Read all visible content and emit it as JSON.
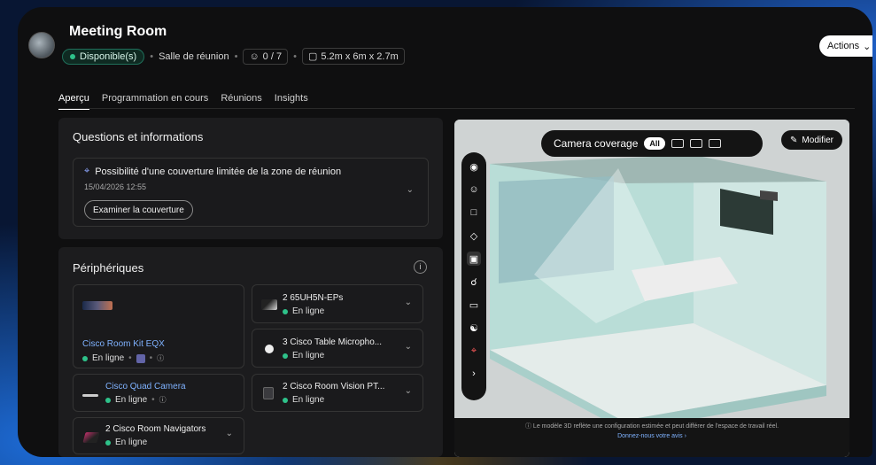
{
  "header": {
    "title": "Meeting Room",
    "status": "Disponible(s)",
    "room_type": "Salle de réunion",
    "capacity": "0 / 7",
    "dimensions": "5.2m x 6m x 2.7m",
    "actions_label": "Actions"
  },
  "tabs": [
    "Aperçu",
    "Programmation en cours",
    "Réunions",
    "Insights"
  ],
  "questions": {
    "title": "Questions et informations",
    "issue": "Possibilité d'une couverture limitée de la zone de réunion",
    "date": "15/04/2026 12:55",
    "button": "Examiner la couverture"
  },
  "devices": {
    "title": "Périphériques",
    "items": [
      {
        "name": "Cisco Room Kit EQX",
        "status": "En ligne"
      },
      {
        "name": "2 65UH5N-EPs",
        "status": "En ligne"
      },
      {
        "name": "3 Cisco Table Micropho...",
        "status": "En ligne"
      },
      {
        "name": "Cisco Quad Camera",
        "status": "En ligne"
      },
      {
        "name": "2 Cisco Room Vision PT...",
        "status": "En ligne"
      },
      {
        "name": "2 Cisco Room Navigators",
        "status": "En ligne"
      }
    ]
  },
  "viewer": {
    "coverage_label": "Camera coverage",
    "all_label": "All",
    "modify_label": "Modifier",
    "note": "Le modèle 3D reflète une configuration estimée et peut différer de l'espace de travail réel.",
    "feedback_link": "Donnez-nous votre avis"
  },
  "colors": {
    "online": "#2ec28a",
    "link": "#7fb2ff",
    "room_glass": "#9fd6cf"
  }
}
